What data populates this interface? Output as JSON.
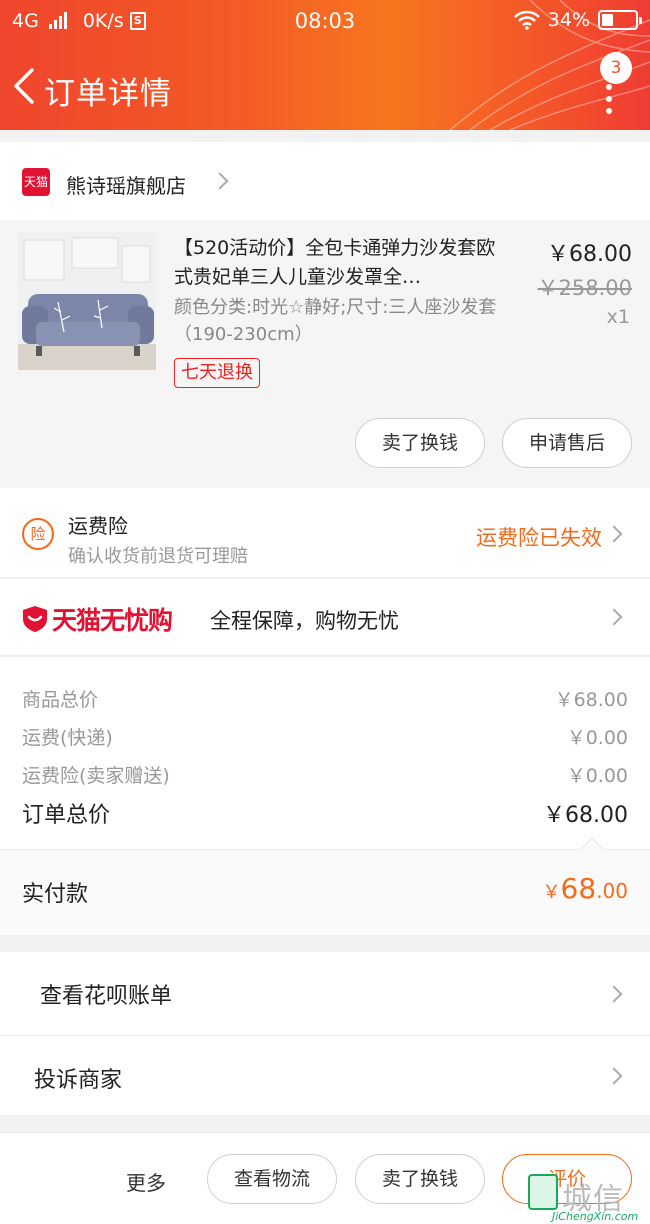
{
  "status_bar": {
    "network": "4G",
    "speed": "0K/s",
    "sim_icon": "S",
    "time": "08:03",
    "battery_percent": "34%",
    "battery_level": 0.34
  },
  "header": {
    "title": "订单详情",
    "badge_count": "3"
  },
  "store": {
    "logo_text": "天猫",
    "name": "熊诗瑶旗舰店"
  },
  "product": {
    "title": "【520活动价】全包卡通弹力沙发套欧式贵妃单三人儿童沙发罩全…",
    "sku": "颜色分类:时光☆静好;尺寸:三人座沙发套（190-230cm）",
    "tag": "七天退换",
    "price": "￥68.00",
    "original_price": "￥258.00",
    "quantity": "x1",
    "btn_sell": "卖了换钱",
    "btn_aftersale": "申请售后"
  },
  "insurance": {
    "icon_text": "险",
    "title": "运费险",
    "subtitle": "确认收货前退货可理赔",
    "status": "运费险已失效"
  },
  "worry_free": {
    "brand": "天猫无忧购",
    "text": "全程保障，购物无忧"
  },
  "summary": {
    "rows": [
      {
        "label": "商品总价",
        "value": "￥68.00"
      },
      {
        "label": "运费(快递)",
        "value": "￥0.00"
      },
      {
        "label": "运费险(卖家赠送)",
        "value": "￥0.00"
      }
    ],
    "total_label": "订单总价",
    "total_value": "￥68.00",
    "paid_label": "实付款",
    "paid_symbol": "￥",
    "paid_int": "68",
    "paid_dec": ".00"
  },
  "links": {
    "huabei": "查看花呗账单",
    "complain": "投诉商家"
  },
  "bottom_bar": {
    "more": "更多",
    "logistics": "查看物流",
    "sell": "卖了换钱",
    "rate": "评价"
  },
  "watermark": {
    "text": "城信",
    "url": "JiChengXin.com"
  },
  "colors": {
    "accent_orange": "#f26a1b",
    "tmall_red": "#e21232"
  }
}
